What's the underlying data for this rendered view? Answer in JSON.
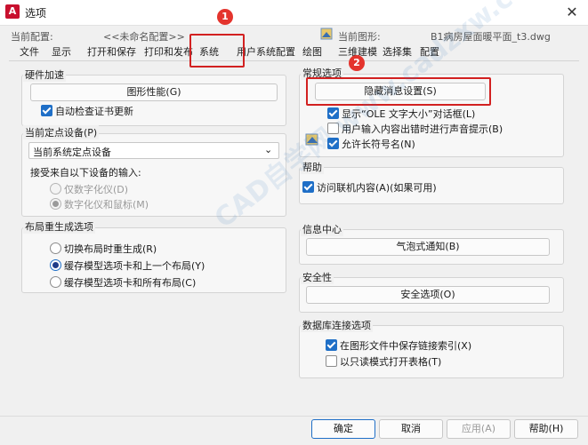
{
  "window": {
    "title": "选项",
    "icon_letter": "A",
    "close": "✕"
  },
  "header": {
    "current_profile_label": "当前配置:",
    "current_profile_value": "<<未命名配置>>",
    "current_drawing_label": "当前图形:",
    "current_drawing_value": "B1病房屋面暖平面_t3.dwg"
  },
  "tabs": [
    "文件",
    "显示",
    "打开和保存",
    "打印和发布",
    "系统",
    "用户系统配置",
    "绘图",
    "三维建模",
    "选择集",
    "配置"
  ],
  "left": {
    "hw_group": {
      "title": "硬件加速",
      "button": "图形性能(G)",
      "auto_check": "自动检查证书更新"
    },
    "pointing_group": {
      "title": "当前定点设备(P)",
      "select_value": "当前系统定点设备",
      "accept_label": "接受来自以下设备的输入:",
      "radio_digitizer_only": "仅数字化仪(D)",
      "radio_digitizer_mouse": "数字化仪和鼠标(M)"
    },
    "layout_group": {
      "title": "布局重生成选项",
      "opt1": "切换布局时重生成(R)",
      "opt2": "缓存模型选项卡和上一个布局(Y)",
      "opt3": "缓存模型选项卡和所有布局(C)"
    }
  },
  "right": {
    "general_group": {
      "title": "常规选项",
      "hidden_msg_button": "隐藏消息设置(S)",
      "ole_dialog": "显示“OLE 文字大小”对话框(L)",
      "beep_on_error": "用户输入内容出错时进行声音提示(B)",
      "allow_long_names": "允许长符号名(N)"
    },
    "help_group": {
      "title": "帮助",
      "online": "访问联机内容(A)(如果可用)"
    },
    "info_group": {
      "title": "信息中心",
      "balloon_button": "气泡式通知(B)"
    },
    "security_group": {
      "title": "安全性",
      "security_button": "安全选项(O)"
    },
    "db_group": {
      "title": "数据库连接选项",
      "store_index": "在图形文件中保存链接索引(X)",
      "readonly": "以只读模式打开表格(T)"
    }
  },
  "annotations": {
    "badge1": "1",
    "badge2": "2"
  },
  "watermark": "CAD自学网  www.cadzxw.com",
  "footer": {
    "ok": "确定",
    "cancel": "取消",
    "apply": "应用(A)",
    "help": "帮助(H)"
  },
  "colors": {
    "accent": "#1f6fc7",
    "highlight": "#d22121"
  }
}
